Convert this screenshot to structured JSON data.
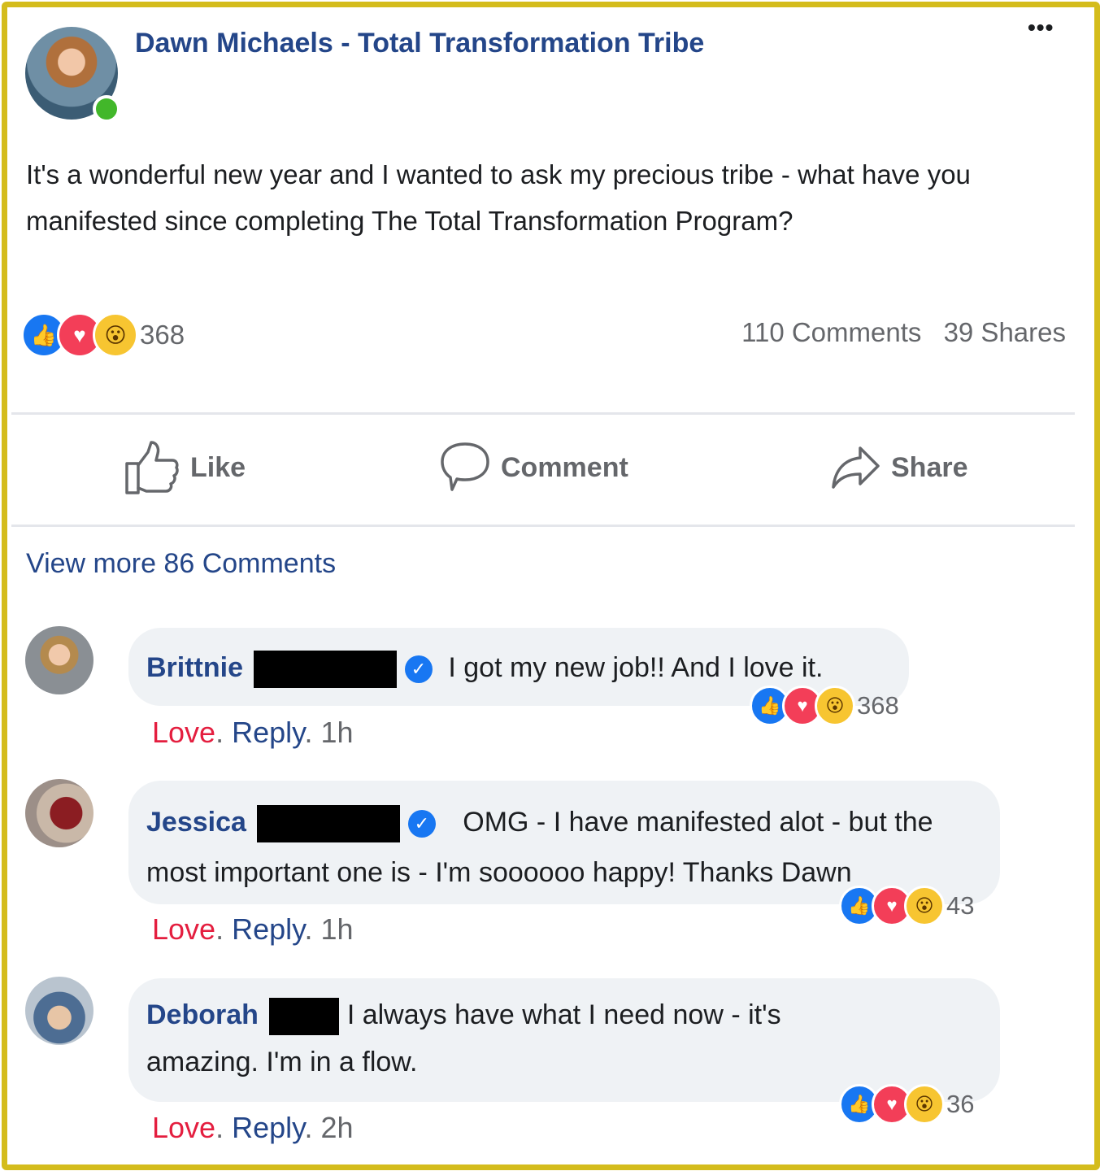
{
  "post": {
    "author": "Dawn Michaels - Total Transformation Tribe",
    "more_icon": "•••",
    "text": "It's a wonderful new year and I wanted to ask my precious tribe - what have you manifested since completing The Total Transformation Program?",
    "reaction_count": "368",
    "comments_count": "110 Comments",
    "shares_count": "39 Shares"
  },
  "actions": {
    "like": "Like",
    "comment": "Comment",
    "share": "Share"
  },
  "view_more": "View more 86 Comments",
  "comments": [
    {
      "name": "Brittnie",
      "text": "I got my new job!! And I love it.",
      "reactions": "368",
      "love": "Love",
      "reply": "Reply",
      "time": "1h"
    },
    {
      "name": "Jessica",
      "text": "OMG - I have manifested alot - but the most important one is - I'm soooooo happy! Thanks Dawn",
      "reactions": "43",
      "love": "Love",
      "reply": "Reply",
      "time": "1h"
    },
    {
      "name": "Deborah",
      "text": "I always have what I need now - it's amazing. I'm in a flow.",
      "reactions": "36",
      "love": "Love",
      "reply": "Reply",
      "time": "2h"
    }
  ],
  "meta_sep": ".",
  "reaction_icons": {
    "like": "👍",
    "love": "♥",
    "wow": "😮"
  },
  "colors": {
    "frame": "#d4bc1c",
    "link": "#244689",
    "love": "#e41e3f",
    "like": "#1877f2",
    "online": "#42b72a"
  }
}
